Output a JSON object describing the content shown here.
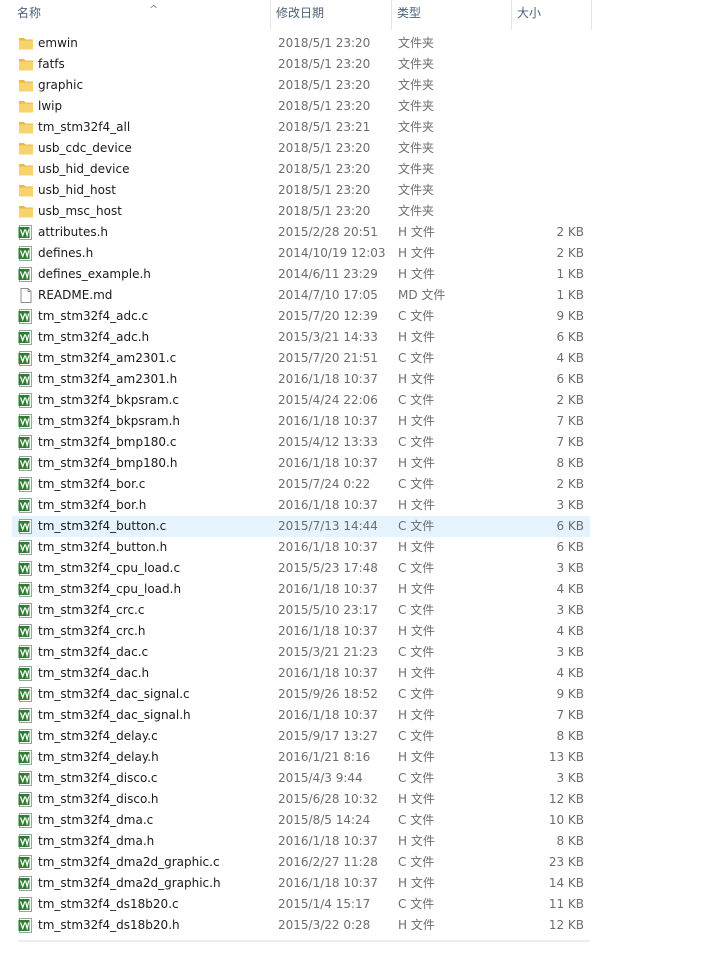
{
  "columns": {
    "name": "名称",
    "date": "修改日期",
    "type": "类型",
    "size": "大小"
  },
  "sort_indicator": "^",
  "files": [
    {
      "name": "emwin",
      "date": "2018/5/1 23:20",
      "type": "文件夹",
      "size": "",
      "icon": "folder-icon"
    },
    {
      "name": "fatfs",
      "date": "2018/5/1 23:20",
      "type": "文件夹",
      "size": "",
      "icon": "folder-icon"
    },
    {
      "name": "graphic",
      "date": "2018/5/1 23:20",
      "type": "文件夹",
      "size": "",
      "icon": "folder-icon"
    },
    {
      "name": "lwip",
      "date": "2018/5/1 23:20",
      "type": "文件夹",
      "size": "",
      "icon": "folder-icon"
    },
    {
      "name": "tm_stm32f4_all",
      "date": "2018/5/1 23:21",
      "type": "文件夹",
      "size": "",
      "icon": "folder-icon"
    },
    {
      "name": "usb_cdc_device",
      "date": "2018/5/1 23:20",
      "type": "文件夹",
      "size": "",
      "icon": "folder-icon"
    },
    {
      "name": "usb_hid_device",
      "date": "2018/5/1 23:20",
      "type": "文件夹",
      "size": "",
      "icon": "folder-icon"
    },
    {
      "name": "usb_hid_host",
      "date": "2018/5/1 23:20",
      "type": "文件夹",
      "size": "",
      "icon": "folder-icon"
    },
    {
      "name": "usb_msc_host",
      "date": "2018/5/1 23:20",
      "type": "文件夹",
      "size": "",
      "icon": "folder-icon"
    },
    {
      "name": "attributes.h",
      "date": "2015/2/28 20:51",
      "type": "H 文件",
      "size": "2 KB",
      "icon": "source-file-icon"
    },
    {
      "name": "defines.h",
      "date": "2014/10/19 12:03",
      "type": "H 文件",
      "size": "2 KB",
      "icon": "source-file-icon"
    },
    {
      "name": "defines_example.h",
      "date": "2014/6/11 23:29",
      "type": "H 文件",
      "size": "1 KB",
      "icon": "source-file-icon"
    },
    {
      "name": "README.md",
      "date": "2014/7/10 17:05",
      "type": "MD 文件",
      "size": "1 KB",
      "icon": "document-icon"
    },
    {
      "name": "tm_stm32f4_adc.c",
      "date": "2015/7/20 12:39",
      "type": "C 文件",
      "size": "9 KB",
      "icon": "source-file-icon"
    },
    {
      "name": "tm_stm32f4_adc.h",
      "date": "2015/3/21 14:33",
      "type": "H 文件",
      "size": "6 KB",
      "icon": "source-file-icon"
    },
    {
      "name": "tm_stm32f4_am2301.c",
      "date": "2015/7/20 21:51",
      "type": "C 文件",
      "size": "4 KB",
      "icon": "source-file-icon"
    },
    {
      "name": "tm_stm32f4_am2301.h",
      "date": "2016/1/18 10:37",
      "type": "H 文件",
      "size": "6 KB",
      "icon": "source-file-icon"
    },
    {
      "name": "tm_stm32f4_bkpsram.c",
      "date": "2015/4/24 22:06",
      "type": "C 文件",
      "size": "2 KB",
      "icon": "source-file-icon"
    },
    {
      "name": "tm_stm32f4_bkpsram.h",
      "date": "2016/1/18 10:37",
      "type": "H 文件",
      "size": "7 KB",
      "icon": "source-file-icon"
    },
    {
      "name": "tm_stm32f4_bmp180.c",
      "date": "2015/4/12 13:33",
      "type": "C 文件",
      "size": "7 KB",
      "icon": "source-file-icon"
    },
    {
      "name": "tm_stm32f4_bmp180.h",
      "date": "2016/1/18 10:37",
      "type": "H 文件",
      "size": "8 KB",
      "icon": "source-file-icon"
    },
    {
      "name": "tm_stm32f4_bor.c",
      "date": "2015/7/24 0:22",
      "type": "C 文件",
      "size": "2 KB",
      "icon": "source-file-icon"
    },
    {
      "name": "tm_stm32f4_bor.h",
      "date": "2016/1/18 10:37",
      "type": "H 文件",
      "size": "3 KB",
      "icon": "source-file-icon"
    },
    {
      "name": "tm_stm32f4_button.c",
      "date": "2015/7/13 14:44",
      "type": "C 文件",
      "size": "6 KB",
      "icon": "source-file-icon",
      "selected": true
    },
    {
      "name": "tm_stm32f4_button.h",
      "date": "2016/1/18 10:37",
      "type": "H 文件",
      "size": "6 KB",
      "icon": "source-file-icon"
    },
    {
      "name": "tm_stm32f4_cpu_load.c",
      "date": "2015/5/23 17:48",
      "type": "C 文件",
      "size": "3 KB",
      "icon": "source-file-icon"
    },
    {
      "name": "tm_stm32f4_cpu_load.h",
      "date": "2016/1/18 10:37",
      "type": "H 文件",
      "size": "4 KB",
      "icon": "source-file-icon"
    },
    {
      "name": "tm_stm32f4_crc.c",
      "date": "2015/5/10 23:17",
      "type": "C 文件",
      "size": "3 KB",
      "icon": "source-file-icon"
    },
    {
      "name": "tm_stm32f4_crc.h",
      "date": "2016/1/18 10:37",
      "type": "H 文件",
      "size": "4 KB",
      "icon": "source-file-icon"
    },
    {
      "name": "tm_stm32f4_dac.c",
      "date": "2015/3/21 21:23",
      "type": "C 文件",
      "size": "3 KB",
      "icon": "source-file-icon"
    },
    {
      "name": "tm_stm32f4_dac.h",
      "date": "2016/1/18 10:37",
      "type": "H 文件",
      "size": "4 KB",
      "icon": "source-file-icon"
    },
    {
      "name": "tm_stm32f4_dac_signal.c",
      "date": "2015/9/26 18:52",
      "type": "C 文件",
      "size": "9 KB",
      "icon": "source-file-icon"
    },
    {
      "name": "tm_stm32f4_dac_signal.h",
      "date": "2016/1/18 10:37",
      "type": "H 文件",
      "size": "7 KB",
      "icon": "source-file-icon"
    },
    {
      "name": "tm_stm32f4_delay.c",
      "date": "2015/9/17 13:27",
      "type": "C 文件",
      "size": "8 KB",
      "icon": "source-file-icon"
    },
    {
      "name": "tm_stm32f4_delay.h",
      "date": "2016/1/21 8:16",
      "type": "H 文件",
      "size": "13 KB",
      "icon": "source-file-icon"
    },
    {
      "name": "tm_stm32f4_disco.c",
      "date": "2015/4/3 9:44",
      "type": "C 文件",
      "size": "3 KB",
      "icon": "source-file-icon"
    },
    {
      "name": "tm_stm32f4_disco.h",
      "date": "2015/6/28 10:32",
      "type": "H 文件",
      "size": "12 KB",
      "icon": "source-file-icon"
    },
    {
      "name": "tm_stm32f4_dma.c",
      "date": "2015/8/5 14:24",
      "type": "C 文件",
      "size": "10 KB",
      "icon": "source-file-icon"
    },
    {
      "name": "tm_stm32f4_dma.h",
      "date": "2016/1/18 10:37",
      "type": "H 文件",
      "size": "8 KB",
      "icon": "source-file-icon"
    },
    {
      "name": "tm_stm32f4_dma2d_graphic.c",
      "date": "2016/2/27 11:28",
      "type": "C 文件",
      "size": "23 KB",
      "icon": "source-file-icon"
    },
    {
      "name": "tm_stm32f4_dma2d_graphic.h",
      "date": "2016/1/18 10:37",
      "type": "H 文件",
      "size": "14 KB",
      "icon": "source-file-icon"
    },
    {
      "name": "tm_stm32f4_ds18b20.c",
      "date": "2015/1/4 15:17",
      "type": "C 文件",
      "size": "11 KB",
      "icon": "source-file-icon"
    },
    {
      "name": "tm_stm32f4_ds18b20.h",
      "date": "2015/3/22 0:28",
      "type": "H 文件",
      "size": "12 KB",
      "icon": "source-file-icon"
    }
  ],
  "colors": {
    "folder": "#f7d36b",
    "folder_dark": "#e8b84a",
    "source_icon": "#2e7d32",
    "selection": "#e5f3ff",
    "header_text": "#4c607a"
  }
}
